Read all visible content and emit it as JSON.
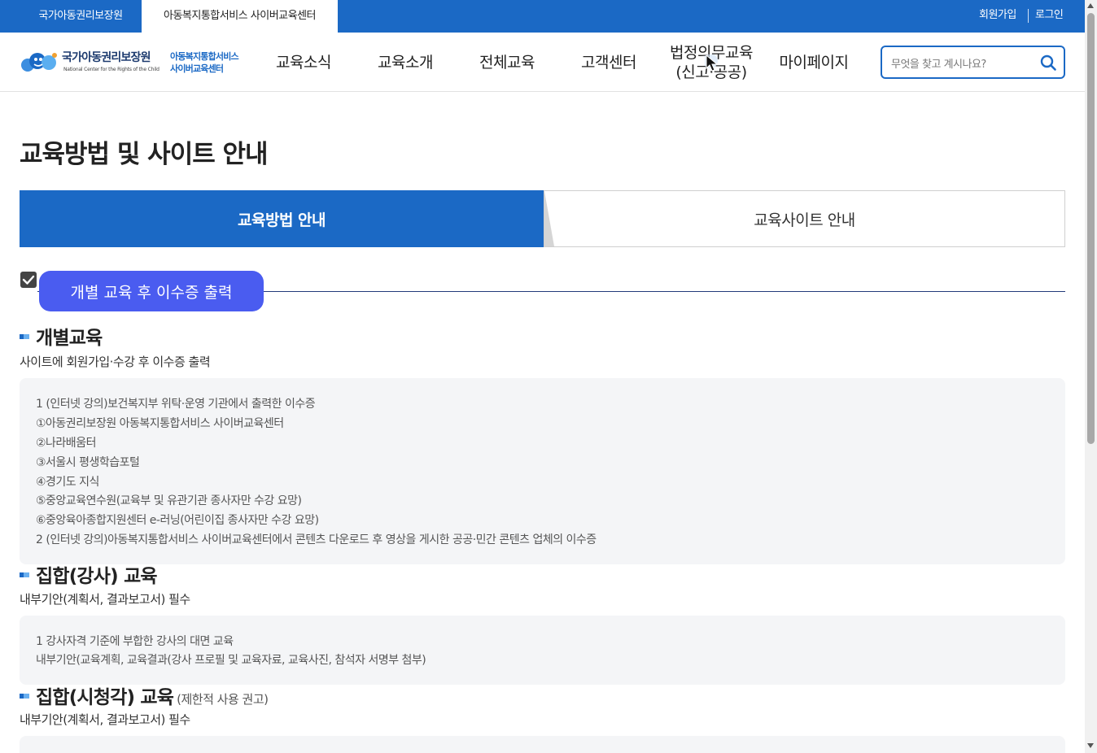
{
  "topbar": {
    "site_tabs": [
      "국가아동권리보장원",
      "아동복지통합서비스 사이버교육센터"
    ],
    "signup": "회원가입",
    "login": "로그인"
  },
  "logo": {
    "name_ko": "국가아동권리보장원",
    "name_en": "National Center for the Rights of the Child",
    "sub_line1": "아동복지통합서비스",
    "sub_line2": "사이버교육센터"
  },
  "nav": {
    "items": [
      "교육소식",
      "교육소개",
      "전체교육",
      "고객센터"
    ],
    "legal_line1": "법정의무교육",
    "legal_line2": "(신고·공공)",
    "mypage": "마이페이지"
  },
  "search": {
    "placeholder": "무엇을 찾고 계시나요?"
  },
  "page": {
    "title": "교육방법 및 사이트 안내",
    "tabs": [
      "교육방법 안내",
      "교육사이트 안내"
    ],
    "badge": "개별 교육 후 이수증 출력"
  },
  "sections": [
    {
      "heading": "개별교육",
      "note": "",
      "sub": "사이트에 회원가입·수강 후 이수증 출력",
      "lines": [
        "1 (인터넷 강의)보건복지부 위탁·운영 기관에서 출력한 이수증",
        "①아동권리보장원 아동복지통합서비스 사이버교육센터",
        "②나라배움터",
        "③서울시 평생학습포털",
        "④경기도 지식",
        "⑤중앙교육연수원(교육부 및 유관기관 종사자만 수강 요망)",
        "⑥중앙육아종합지원센터 e-러닝(어린이집 종사자만 수강 요망)",
        "2 (인터넷 강의)아동복지통합서비스 사이버교육센터에서 콘텐츠 다운로드 후 영상을 게시한 공공·민간 콘텐츠 업체의 이수증"
      ]
    },
    {
      "heading": "집합(강사) 교육",
      "note": "",
      "sub": "내부기안(계획서, 결과보고서) 필수",
      "lines": [
        "1 강사자격 기준에 부합한 강사의 대면 교육",
        "내부기안(교육계획, 교육결과(강사 프로필 및 교육자료, 교육사진, 참석자 서명부 첨부)"
      ]
    },
    {
      "heading": "집합(시청각) 교육",
      "note": "(제한적 사용 권고)",
      "sub": "내부기안(계획서, 결과보고서) 필수",
      "lines": []
    }
  ],
  "colors": {
    "brand_blue": "#1b69c5",
    "badge_blue": "#4a5cf0",
    "box_gray": "#f4f5f7"
  }
}
